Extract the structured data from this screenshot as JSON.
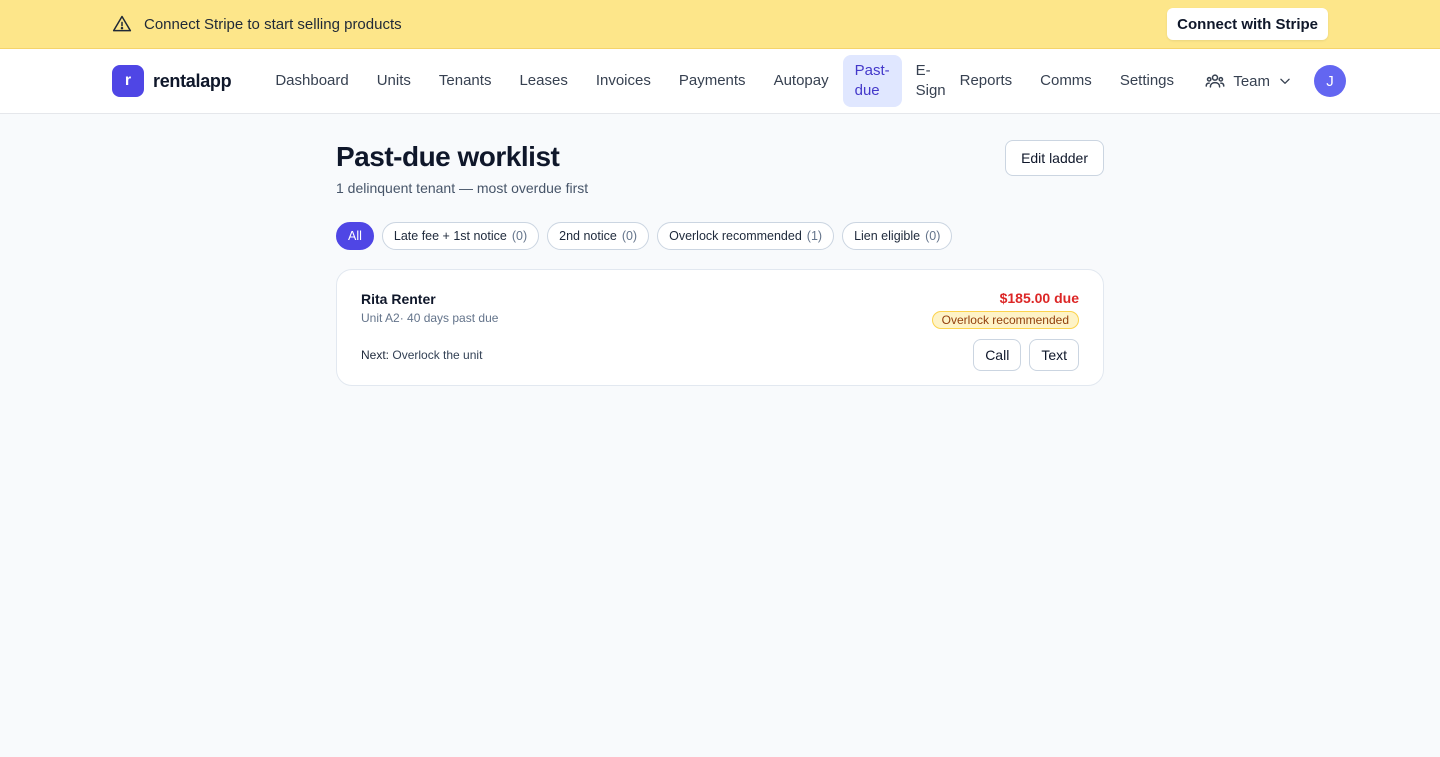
{
  "banner": {
    "message": "Connect Stripe to start selling products",
    "button_label": "Connect with Stripe"
  },
  "nav": {
    "brand_letter": "r",
    "brand_name": "rentalapp",
    "items": [
      {
        "label": "Dashboard"
      },
      {
        "label": "Units"
      },
      {
        "label": "Tenants"
      },
      {
        "label": "Leases"
      },
      {
        "label": "Invoices"
      },
      {
        "label": "Payments"
      },
      {
        "label": "Autopay"
      },
      {
        "label": "Past-due",
        "active": true
      },
      {
        "label": "E-Sign"
      },
      {
        "label": "Reports"
      },
      {
        "label": "Comms"
      },
      {
        "label": "Settings"
      }
    ],
    "team_label": "Team",
    "avatar_initial": "J"
  },
  "page": {
    "title": "Past-due worklist",
    "subtitle": "1 delinquent tenant — most overdue first",
    "edit_button_label": "Edit ladder"
  },
  "filters": [
    {
      "label": "All",
      "count": null,
      "active": true
    },
    {
      "label": "Late fee + 1st notice",
      "count": "(0)"
    },
    {
      "label": "2nd notice",
      "count": "(0)"
    },
    {
      "label": "Overlock recommended",
      "count": "(1)"
    },
    {
      "label": "Lien eligible",
      "count": "(0)"
    }
  ],
  "tenants": [
    {
      "name": "Rita Renter",
      "meta": "Unit A2· 40 days past due",
      "next_label": "Next:",
      "next_value": "Overlock the unit",
      "amount": "$185.00 due",
      "status": "Overlock recommended",
      "call_label": "Call",
      "text_label": "Text"
    }
  ],
  "colors": {
    "accent": "#4f46e5",
    "banner_bg": "#fde68a",
    "amount_due": "#dc2626",
    "badge_bg": "#fef3c7"
  }
}
